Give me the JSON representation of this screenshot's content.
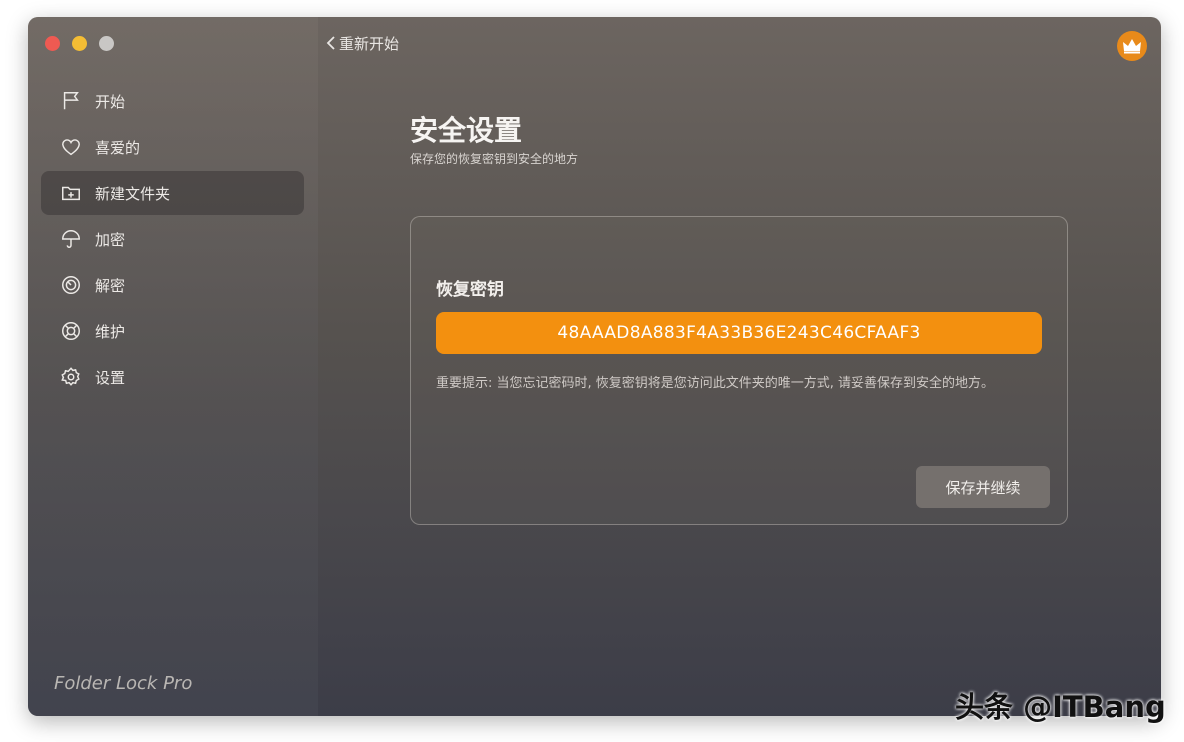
{
  "window": {
    "back_label": "重新开始"
  },
  "sidebar": {
    "items": [
      {
        "label": "开始",
        "icon": "flag-icon"
      },
      {
        "label": "喜爱的",
        "icon": "heart-icon"
      },
      {
        "label": "新建文件夹",
        "icon": "new-folder-icon"
      },
      {
        "label": "加密",
        "icon": "umbrella-icon"
      },
      {
        "label": "解密",
        "icon": "disc-icon"
      },
      {
        "label": "维护",
        "icon": "lifebuoy-icon"
      },
      {
        "label": "设置",
        "icon": "gear-icon"
      }
    ],
    "active_index": 2,
    "brand": "Folder Lock Pro"
  },
  "main": {
    "title": "安全设置",
    "subtitle": "保存您的恢复密钥到安全的地方",
    "panel": {
      "label": "恢复密钥",
      "recovery_key": "48AAAD8A883F4A33B36E243C46CFAAF3",
      "hint": "重要提示: 当您忘记密码时, 恢复密钥将是您访问此文件夹的唯一方式, 请妥善保存到安全的地方。",
      "save_button": "保存并继续"
    }
  },
  "colors": {
    "accent": "#f3900f",
    "crown": "#e88a1a",
    "close": "#ef5a52",
    "minimize": "#f4bd34"
  },
  "watermark": "头条 @ITBang"
}
